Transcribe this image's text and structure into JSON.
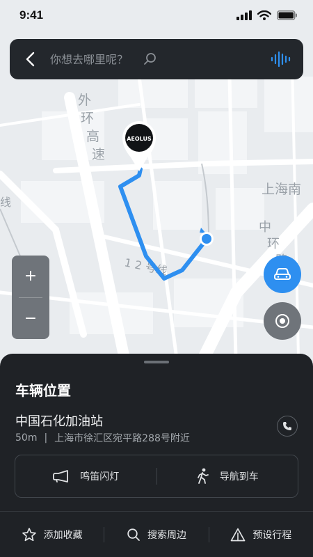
{
  "status": {
    "time": "9:41"
  },
  "search": {
    "placeholder": "你想去哪里呢？"
  },
  "map": {
    "labels": {
      "road_outer_1": "外",
      "road_outer_2": "环",
      "road_outer_3": "高",
      "road_outer_4": "速",
      "station": "上海南",
      "road_zhonghuan_1": "中",
      "road_zhonghuan_2": "环",
      "road_zhonghuan_3": "路",
      "line12": "1 2 号线",
      "left_edge": "线"
    },
    "brand_logo": "AEOLUS"
  },
  "zoom": {
    "in": "+",
    "out": "−"
  },
  "sheet": {
    "title": "车辆位置",
    "place_name": "中国石化加油站",
    "distance": "50m",
    "separator": "|",
    "address": "上海市徐汇区宛平路288号附近",
    "actions": {
      "horn_flash": "鸣笛闪灯",
      "navigate_to_car": "导航到车"
    },
    "bottom": {
      "favorite": "添加收藏",
      "search_nearby": "搜索周边",
      "preset_trip": "预设行程"
    }
  },
  "colors": {
    "accent": "#2e8ff0",
    "route": "#2e8ff0",
    "sheet_bg": "#1f2226",
    "search_bg": "#23272c"
  },
  "icons": {
    "back": "chevron-left-icon",
    "search": "search-icon",
    "voice": "voice-wave-icon",
    "car": "car-icon",
    "locate": "locate-icon",
    "phone": "phone-icon",
    "horn": "horn-icon",
    "walk": "walk-icon",
    "star": "star-icon",
    "magnifier": "search-icon",
    "warning": "warning-triangle-icon"
  }
}
